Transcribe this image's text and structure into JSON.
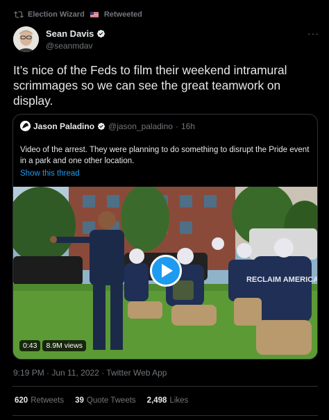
{
  "retweet": {
    "label": "Election Wizard",
    "suffix": "Retweeted",
    "flag_icon": "us-flag-icon"
  },
  "author": {
    "name": "Sean Davis",
    "handle": "@seanmdav"
  },
  "tweet": {
    "text": "It’s nice of the Feds to film their weekend intramural scrimmages so we can see the great teamwork on display."
  },
  "quote": {
    "name": "Jason Paladino",
    "handle": "@jason_paladino",
    "time": "16h",
    "text": "Video of the arrest. They were planning to do something to disrupt the Pride event in a park and one other location.",
    "show_thread": "Show this thread",
    "video": {
      "duration": "0:43",
      "views": "8.9M views",
      "shirt_text": "RECLAIM AMERICA"
    }
  },
  "meta": {
    "timestamp": "9:19 PM · Jun 11, 2022 · Twitter Web App"
  },
  "stats": {
    "retweets_count": "620",
    "retweets_label": "Retweets",
    "quotes_count": "39",
    "quotes_label": "Quote Tweets",
    "likes_count": "2,498",
    "likes_label": "Likes"
  },
  "colors": {
    "accent": "#1d9bf0",
    "text": "#e7e9ea",
    "muted": "#71767b",
    "border": "#2f3336"
  }
}
